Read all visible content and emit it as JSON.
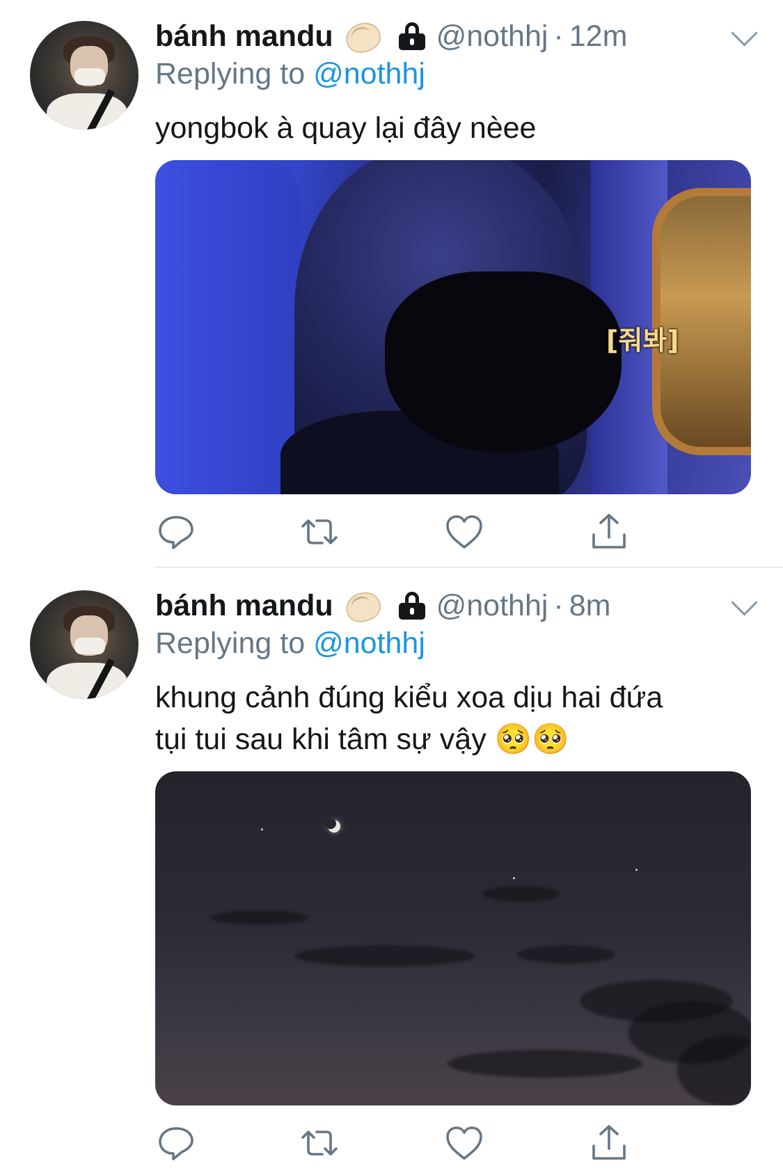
{
  "tweets": [
    {
      "display_name": "bánh mandu",
      "name_emoji": "dumpling-emoji",
      "handle": "@nothhj",
      "separator": "·",
      "time": "12m",
      "replying_prefix": "Replying to",
      "replying_to": "@nothhj",
      "text_lines": [
        "yongbok à quay lại đây nèee"
      ],
      "media": {
        "kind": "photo-airplane-seat",
        "caption": "[줘봐]"
      }
    },
    {
      "display_name": "bánh mandu",
      "name_emoji": "dumpling-emoji",
      "handle": "@nothhj",
      "separator": "·",
      "time": "8m",
      "replying_prefix": "Replying to",
      "replying_to": "@nothhj",
      "text_lines": [
        "khung cảnh đúng kiểu xoa dịu hai đứa",
        "tụi tui sau khi tâm sự vậy 🥺🥺"
      ],
      "media": {
        "kind": "photo-night-sky-moon"
      }
    }
  ],
  "icons": {
    "lock": "lock-icon",
    "chevron": "chevron-down-icon",
    "reply": "reply-icon",
    "retweet": "retweet-icon",
    "like": "heart-icon",
    "share": "share-icon"
  },
  "colors": {
    "text": "#14171a",
    "secondary": "#657786",
    "link": "#1b95e0",
    "icon": "#657786",
    "divider": "#e6ecf0"
  }
}
